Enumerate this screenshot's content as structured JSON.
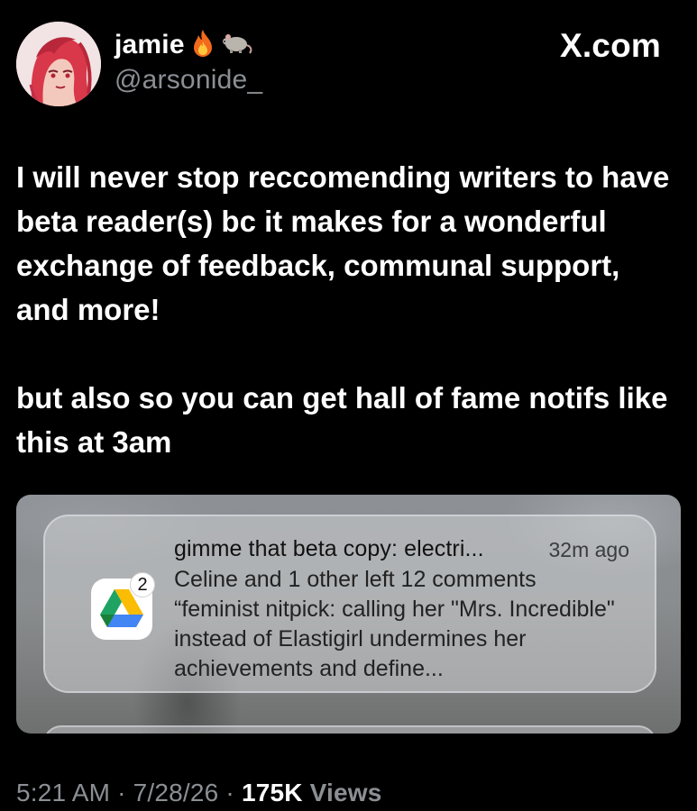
{
  "author": {
    "display_name": "jamie",
    "handle": "@arsonide_",
    "name_emojis": [
      "fire-icon",
      "rat-icon"
    ]
  },
  "site_label": "X.com",
  "post": {
    "paragraph_1": "I will never stop reccomending writers to have beta reader(s) bc it makes for a wonderful exchange of feedback, communal support, and more!",
    "paragraph_2": "but also so you can get hall of fame notifs like this at 3am"
  },
  "notification": {
    "title": "gimme that beta copy: electri...",
    "time": "32m ago",
    "badge_count": "2",
    "app_icon": "google-drive-icon",
    "line_1": "Celine and 1 other left 12 comments",
    "line_2": "“feminist nitpick: calling her \"Mrs. Incredible\" instead of Elastigirl undermines her achievements and define..."
  },
  "footer": {
    "time": "5:21 AM",
    "date": "7/28/26",
    "views_count": "175K",
    "views_label": "Views",
    "separator": " · "
  },
  "colors": {
    "background": "#000000",
    "text": "#ffffff",
    "muted": "#8b8f94"
  }
}
